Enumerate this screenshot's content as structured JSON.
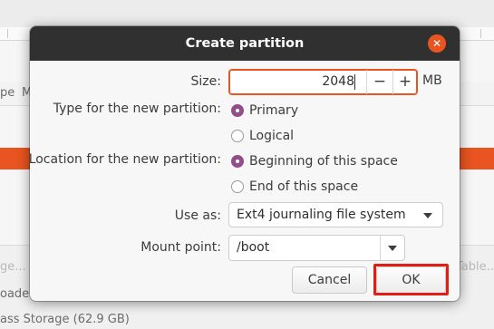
{
  "background": {
    "column_fragments": [
      "pe",
      "M"
    ],
    "faded_left": "ge...",
    "faded_right": "Table...",
    "bootloader_partial": "oader installation:",
    "storage_device": "ass Storage (62.9 GB)"
  },
  "dialog": {
    "title": "Create partition",
    "close_glyph": "✕",
    "size_label": "Size:",
    "size_value": "2048",
    "decrement_glyph": "−",
    "increment_glyph": "+",
    "size_unit": "MB",
    "type_label": "Type for the new partition:",
    "type_options": [
      {
        "label": "Primary",
        "checked": true
      },
      {
        "label": "Logical",
        "checked": false
      }
    ],
    "location_label": "Location for the new partition:",
    "location_options": [
      {
        "label": "Beginning of this space",
        "checked": true
      },
      {
        "label": "End of this space",
        "checked": false
      }
    ],
    "use_as_label": "Use as:",
    "use_as_value": "Ext4 journaling file system",
    "mount_label": "Mount point:",
    "mount_value": "/boot",
    "cancel_label": "Cancel",
    "ok_label": "OK"
  },
  "colors": {
    "accent_orange": "#e95420",
    "radio_purple": "#924d8b",
    "title_bar": "#303030",
    "highlight_red": "#e01e12"
  }
}
